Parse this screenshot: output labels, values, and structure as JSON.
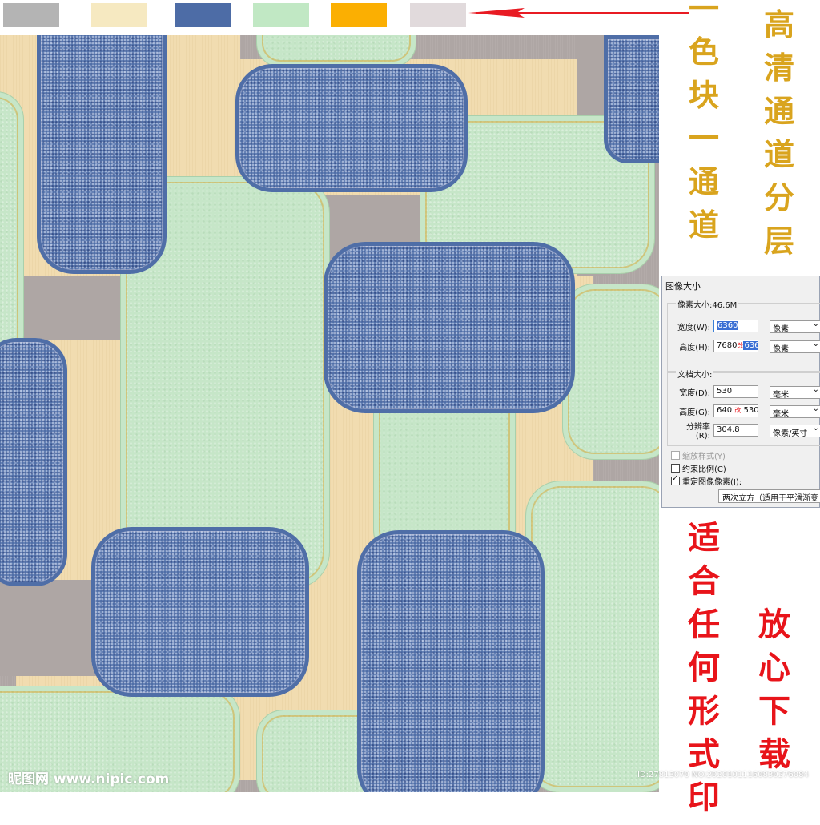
{
  "palette": {
    "label": "color swatches",
    "swatches": [
      {
        "name": "gray",
        "hex": "#b4b4b4"
      },
      {
        "name": "tan",
        "hex": "#f6e9c1"
      },
      {
        "name": "blue",
        "hex": "#4d6ca6"
      },
      {
        "name": "mint",
        "hex": "#c1e8c4"
      },
      {
        "name": "orange",
        "hex": "#fbaf02"
      },
      {
        "name": "light-gray",
        "hex": "#e1dadc"
      }
    ],
    "arrow_color": "#e81b23"
  },
  "pattern": {
    "colors": {
      "background": "#aea6a4",
      "tan": "#f1dcb0",
      "green": "#c6e6c8",
      "blue": "#4f6ea7",
      "stitch": "#d6aa3c"
    }
  },
  "captions": {
    "gold_right": [
      "高",
      "清",
      "通",
      "道",
      "分",
      "层"
    ],
    "gold_left": [
      "一",
      "色",
      "块",
      "一",
      "通",
      "道"
    ],
    "red_left": [
      "适",
      "合",
      "任",
      "何",
      "形",
      "式",
      "印"
    ],
    "red_right": [
      "放",
      "心",
      "下",
      "载"
    ]
  },
  "dialog": {
    "title": "图像大小",
    "pixel_group": "像素大小:46.6M",
    "width_label": "宽度(W):",
    "width_value": "6360",
    "width_unit": "像素",
    "height_label": "高度(H):",
    "height_value": "7680",
    "height_new": "6360",
    "height_unit": "像素",
    "doc_group": "文档大小:",
    "doc_width_label": "宽度(D):",
    "doc_width_value": "530",
    "doc_width_unit": "毫米",
    "doc_height_label": "高度(G):",
    "doc_height_value": "640",
    "doc_height_new": "530",
    "doc_height_unit": "毫米",
    "resolution_label": "分辨率(R):",
    "resolution_value": "304.8",
    "resolution_unit": "像素/英寸",
    "scale_styles": "缩放样式(Y)",
    "constrain": "约束比例(C)",
    "resample": "重定图像像素(I):",
    "resample_method": "两次立方（适用于平滑渐变",
    "mark": "改"
  },
  "watermark": {
    "left": "昵图网 www.nipic.com",
    "right": "ID:27813070 NO:20201011160830276084"
  }
}
